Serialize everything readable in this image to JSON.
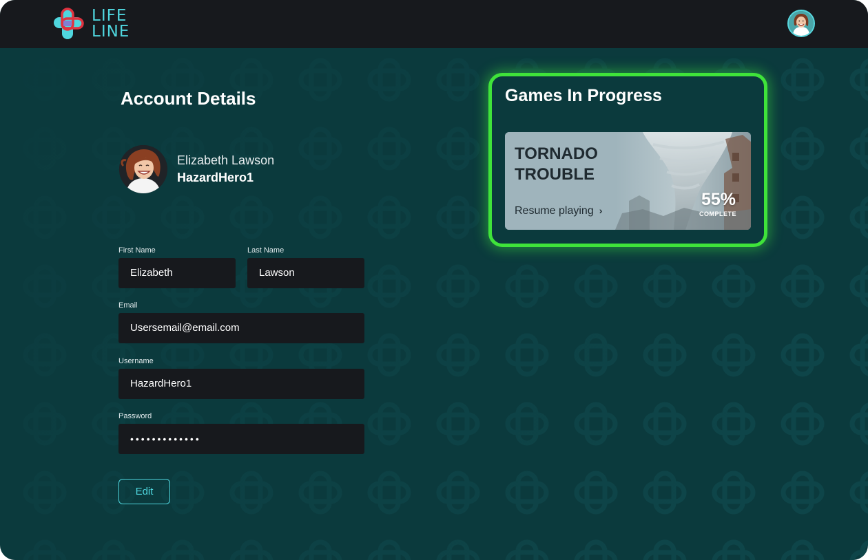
{
  "brand": {
    "logo_line1": "LIFE",
    "logo_line2": "LINE",
    "accent_color": "#4fd6de",
    "logo_red": "#e0323f"
  },
  "header": {
    "avatar_icon": "user-avatar-icon"
  },
  "account": {
    "title": "Account Details",
    "display_name": "Elizabeth Lawson",
    "username": "HazardHero1",
    "fields": {
      "first_name": {
        "label": "First Name",
        "value": "Elizabeth"
      },
      "last_name": {
        "label": "Last Name",
        "value": "Lawson"
      },
      "email": {
        "label": "Email",
        "value": "Usersemail@email.com"
      },
      "username": {
        "label": "Username",
        "value": "HazardHero1"
      },
      "password": {
        "label": "Password",
        "value": "•••••••••••••"
      }
    },
    "edit_label": "Edit"
  },
  "games": {
    "title": "Games In Progress",
    "highlight_color": "#3fe33a",
    "items": [
      {
        "title_line1": "TORNADO",
        "title_line2": "TROUBLE",
        "resume_label": "Resume playing",
        "progress_percent": 55,
        "progress_text": "55%",
        "progress_label": "COMPLETE"
      }
    ]
  }
}
